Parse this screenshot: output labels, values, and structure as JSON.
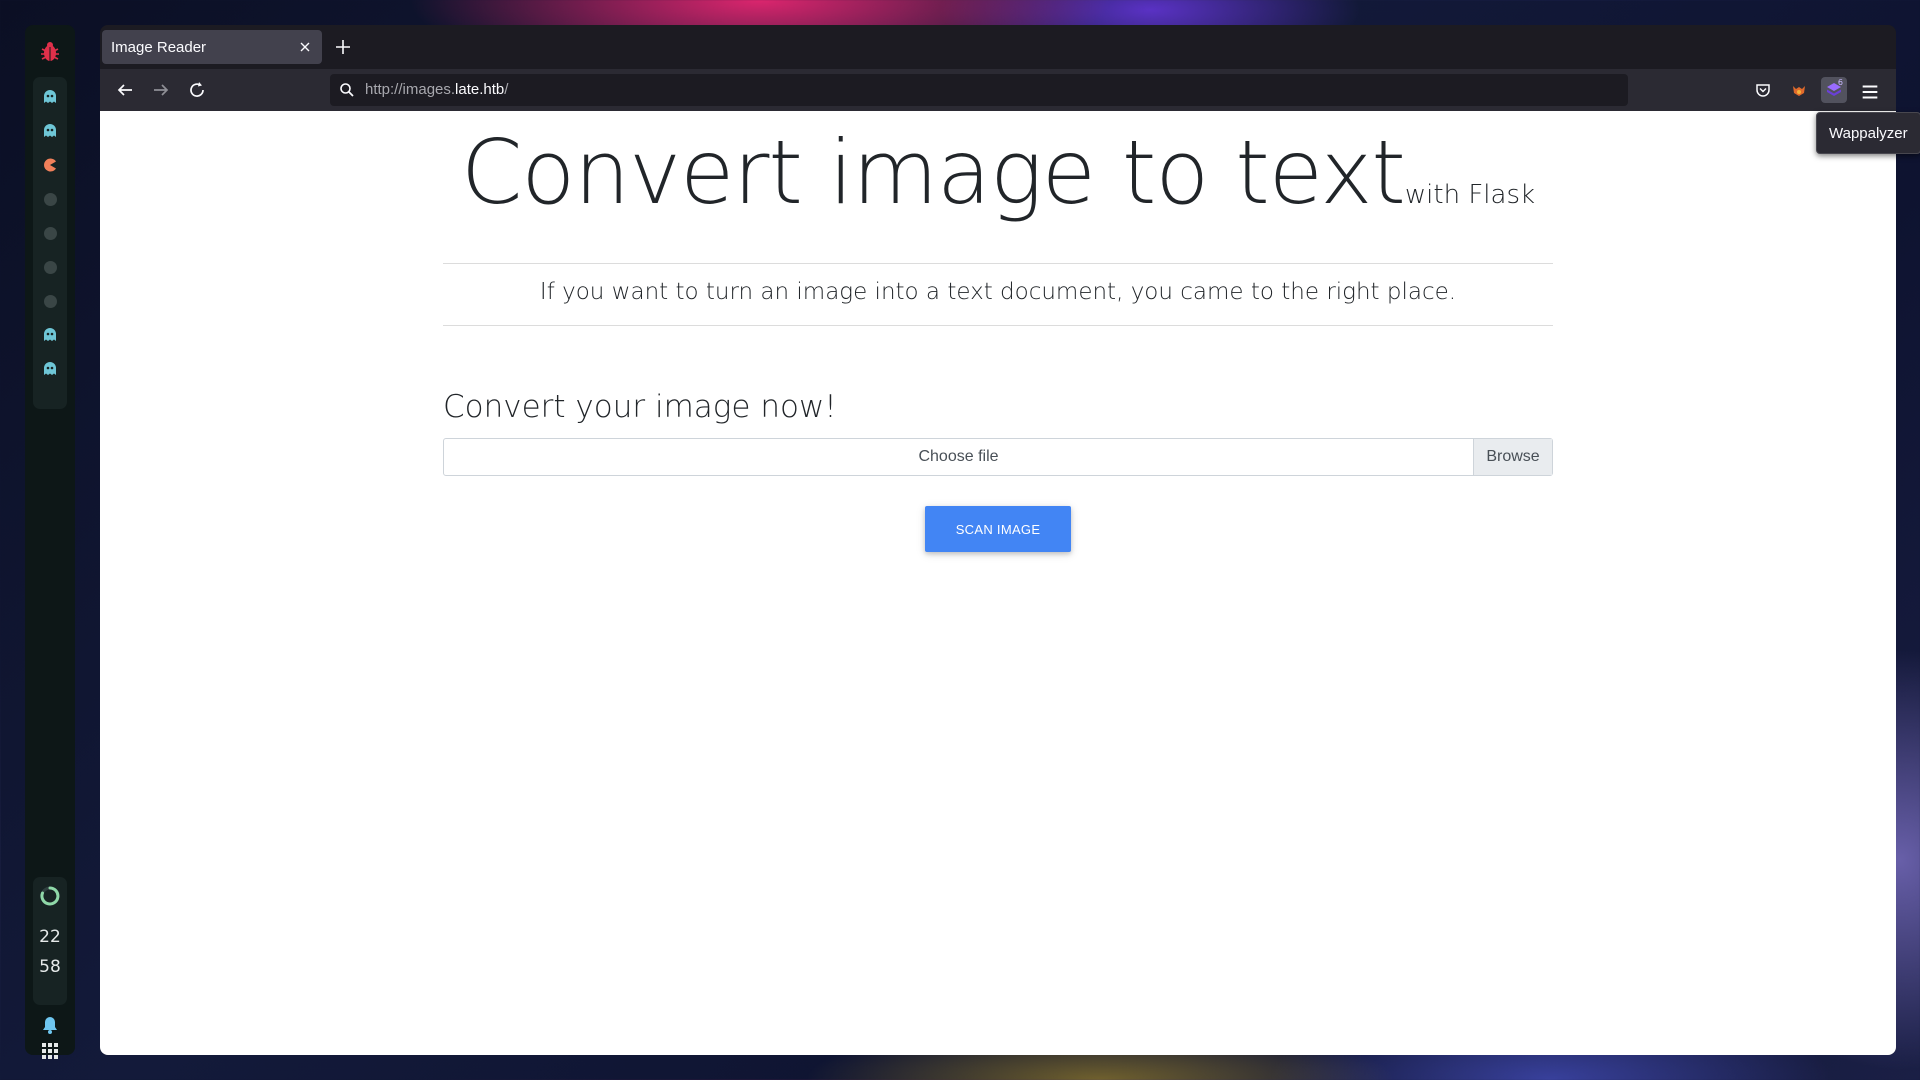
{
  "dock": {
    "clock_hours": "22",
    "clock_minutes": "58"
  },
  "browser": {
    "tab_title": "Image Reader",
    "url_prefix": "http://images.",
    "url_domain": "late.htb",
    "url_suffix": "/",
    "extension_badge": "6",
    "tooltip": "Wappalyzer"
  },
  "page": {
    "title": "Convert image to text",
    "title_suffix": "with Flask",
    "lead": "If you want to turn an image into a text document, you came to the right place.",
    "form_heading": "Convert your image now!",
    "file_placeholder": "Choose file",
    "browse_label": "Browse",
    "scan_button": "SCAN IMAGE"
  },
  "colors": {
    "accent_button": "#4285f4",
    "dock_workspace_active": "#6ec6d6",
    "dock_workspace_special": "#f0805a",
    "dock_logo": "#e0304a"
  }
}
